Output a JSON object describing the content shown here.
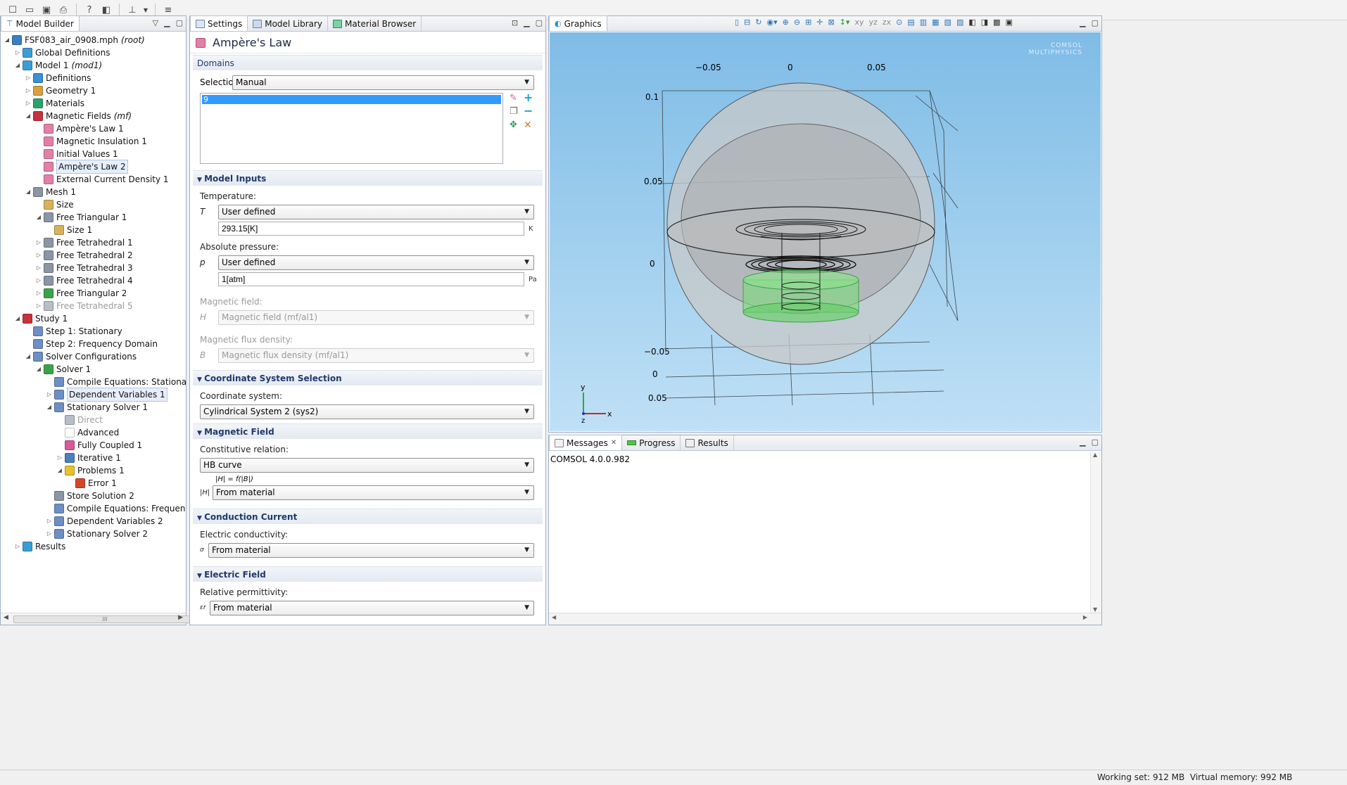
{
  "model_builder": {
    "tab_label": "Model Builder",
    "tree": [
      {
        "label": "FSF083_air_0908.mph",
        "tag": "(root)",
        "level": 0,
        "toggle": "open",
        "icon": "mph-file-icon",
        "color": "#3a7fc1"
      },
      {
        "label": "Global Definitions",
        "level": 1,
        "toggle": "closed",
        "icon": "globe-icon",
        "color": "#3b9dd6"
      },
      {
        "label": "Model 1",
        "tag": "(mod1)",
        "level": 1,
        "toggle": "open",
        "icon": "model-cube-icon",
        "color": "#3b9dd6"
      },
      {
        "label": "Definitions",
        "level": 2,
        "toggle": "closed",
        "icon": "definitions-icon",
        "color": "#3b8fd6"
      },
      {
        "label": "Geometry 1",
        "level": 2,
        "toggle": "closed",
        "icon": "geometry-icon",
        "color": "#d9a040"
      },
      {
        "label": "Materials",
        "level": 2,
        "toggle": "closed",
        "icon": "materials-icon",
        "color": "#2aa36a"
      },
      {
        "label": "Magnetic Fields",
        "tag": "(mf)",
        "level": 2,
        "toggle": "open",
        "icon": "magnetic-fields-icon",
        "color": "#c8323a"
      },
      {
        "label": "Ampère's Law 1",
        "level": 3,
        "icon": "feature-icon",
        "color": "#e57fa8"
      },
      {
        "label": "Magnetic Insulation 1",
        "level": 3,
        "icon": "feature-icon",
        "color": "#e57fa8"
      },
      {
        "label": "Initial Values 1",
        "level": 3,
        "icon": "feature-icon",
        "color": "#e57fa8"
      },
      {
        "label": "Ampère's Law 2",
        "level": 3,
        "icon": "feature-icon",
        "color": "#e57fa8",
        "selected": true
      },
      {
        "label": "External Current Density 1",
        "level": 3,
        "icon": "feature-icon",
        "color": "#e57fa8"
      },
      {
        "label": "Mesh 1",
        "level": 2,
        "toggle": "open",
        "icon": "mesh-icon",
        "color": "#8a96a6"
      },
      {
        "label": "Size",
        "level": 3,
        "icon": "size-icon",
        "color": "#d8b25a"
      },
      {
        "label": "Free Triangular 1",
        "level": 3,
        "toggle": "open",
        "icon": "free-triangular-icon",
        "color": "#8a96a6"
      },
      {
        "label": "Size 1",
        "level": 4,
        "icon": "size-icon",
        "color": "#d8b25a"
      },
      {
        "label": "Free Tetrahedral 1",
        "level": 3,
        "toggle": "closed",
        "icon": "free-tetrahedral-icon",
        "color": "#8a96a6"
      },
      {
        "label": "Free Tetrahedral 2",
        "level": 3,
        "toggle": "closed",
        "icon": "free-tetrahedral-icon",
        "color": "#8a96a6"
      },
      {
        "label": "Free Tetrahedral 3",
        "level": 3,
        "toggle": "closed",
        "icon": "free-tetrahedral-icon",
        "color": "#8a96a6"
      },
      {
        "label": "Free Tetrahedral 4",
        "level": 3,
        "toggle": "closed",
        "icon": "free-tetrahedral-icon",
        "color": "#8a96a6"
      },
      {
        "label": "Free Triangular 2",
        "level": 3,
        "toggle": "closed",
        "icon": "free-triangular-icon",
        "color": "#3aa34a"
      },
      {
        "label": "Free Tetrahedral 5",
        "level": 3,
        "toggle": "closed",
        "icon": "free-tetrahedral-icon",
        "color": "#b8bec8",
        "disabled": true
      },
      {
        "label": "Study 1",
        "level": 1,
        "toggle": "open",
        "icon": "study-icon",
        "color": "#c8323a"
      },
      {
        "label": "Step 1: Stationary",
        "level": 2,
        "icon": "step-stationary-icon",
        "color": "#6d8fc4"
      },
      {
        "label": "Step 2: Frequency Domain",
        "level": 2,
        "icon": "step-frequency-icon",
        "color": "#6d8fc4"
      },
      {
        "label": "Solver Configurations",
        "level": 2,
        "toggle": "open",
        "icon": "solver-configurations-icon",
        "color": "#6d8fc4"
      },
      {
        "label": "Solver 1",
        "level": 3,
        "toggle": "open",
        "icon": "solver-icon",
        "color": "#3aa34a"
      },
      {
        "label": "Compile Equations: Stationary",
        "level": 4,
        "icon": "compile-icon",
        "color": "#6d8fc4"
      },
      {
        "label": "Dependent Variables 1",
        "level": 4,
        "toggle": "closed",
        "icon": "dependent-variables-icon",
        "color": "#6d8fc4",
        "selected": true
      },
      {
        "label": "Stationary Solver 1",
        "level": 4,
        "toggle": "open",
        "icon": "stationary-solver-icon",
        "color": "#6d8fc4"
      },
      {
        "label": "Direct",
        "level": 5,
        "icon": "direct-icon",
        "color": "#b8bec8",
        "disabled": true
      },
      {
        "label": "Advanced",
        "level": 5,
        "icon": "advanced-icon",
        "color": "#ffffff"
      },
      {
        "label": "Fully Coupled 1",
        "level": 5,
        "icon": "fully-coupled-icon",
        "color": "#d85a9a"
      },
      {
        "label": "Iterative 1",
        "level": 5,
        "toggle": "closed",
        "icon": "iterative-icon",
        "color": "#4a7fc1"
      },
      {
        "label": "Problems 1",
        "level": 5,
        "toggle": "open",
        "icon": "problems-icon",
        "color": "#e8c030"
      },
      {
        "label": "Error 1",
        "level": 6,
        "icon": "error-icon",
        "color": "#d9432b"
      },
      {
        "label": "Store Solution 2",
        "level": 4,
        "icon": "store-solution-icon",
        "color": "#8a96a6"
      },
      {
        "label": "Compile Equations: Frequency Doma",
        "level": 4,
        "icon": "compile-icon",
        "color": "#6d8fc4"
      },
      {
        "label": "Dependent Variables 2",
        "level": 4,
        "toggle": "closed",
        "icon": "dependent-variables-icon",
        "color": "#6d8fc4"
      },
      {
        "label": "Stationary Solver 2",
        "level": 4,
        "toggle": "closed",
        "icon": "stationary-solver-icon",
        "color": "#6d8fc4"
      },
      {
        "label": "Results",
        "level": 1,
        "toggle": "closed",
        "icon": "results-icon",
        "color": "#3b9dd6"
      }
    ]
  },
  "settings": {
    "tabs": [
      {
        "label": "Settings",
        "active": true
      },
      {
        "label": "Model Library"
      },
      {
        "label": "Material Browser"
      }
    ],
    "title": "Ampère's Law",
    "domains": {
      "header": "Domains",
      "selection_label": "Selection:",
      "selection_value": "Manual",
      "list_items": [
        "9"
      ]
    },
    "model_inputs": {
      "header": "Model Inputs",
      "temperature_label": "Temperature:",
      "temperature_symbol": "T",
      "temperature_mode": "User defined",
      "temperature_value": "293.15[K]",
      "temperature_unit": "K",
      "pressure_label": "Absolute pressure:",
      "pressure_symbol": "p",
      "pressure_mode": "User defined",
      "pressure_value": "1[atm]",
      "pressure_unit": "Pa",
      "magnetic_field_label": "Magnetic field:",
      "magnetic_field_symbol": "H",
      "magnetic_field_value": "Magnetic field (mf/al1)",
      "flux_density_label": "Magnetic flux density:",
      "flux_density_symbol": "B",
      "flux_density_value": "Magnetic flux density (mf/al1)"
    },
    "coordinate_system": {
      "header": "Coordinate System Selection",
      "label": "Coordinate system:",
      "value": "Cylindrical System 2 (sys2)"
    },
    "magnetic_field": {
      "header": "Magnetic Field",
      "label": "Constitutive relation:",
      "value": "HB curve",
      "equation": "|H| = f(|B|)",
      "param_symbol": "|H|",
      "param_value": "From material"
    },
    "conduction_current": {
      "header": "Conduction Current",
      "label": "Electric conductivity:",
      "symbol": "σ",
      "value": "From material"
    },
    "electric_field": {
      "header": "Electric Field",
      "label": "Relative permittivity:",
      "symbol": "εr",
      "value": "From material"
    }
  },
  "graphics": {
    "tab_label": "Graphics",
    "logo_line1": "COMSOL",
    "logo_line2": "MULTIPHYSICS",
    "top_ticks": [
      "−0.05",
      "0",
      "0.05"
    ],
    "left_ticks": [
      "0.1",
      "0.05",
      "0",
      "−0.05",
      "0",
      "0.05"
    ],
    "triad": {
      "x": "x",
      "y": "y",
      "z": "z"
    }
  },
  "messages": {
    "tabs": [
      {
        "label": "Messages",
        "active": true
      },
      {
        "label": "Progress"
      },
      {
        "label": "Results"
      }
    ],
    "content": "COMSOL 4.0.0.982"
  },
  "status": {
    "working_set": "Working set: 912 MB",
    "virtual_memory": "Virtual memory: 992 MB"
  }
}
